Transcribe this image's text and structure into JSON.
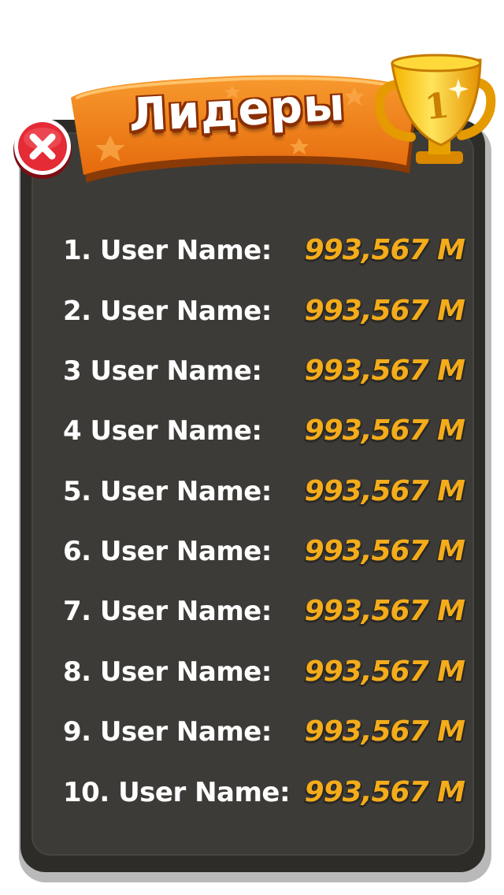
{
  "title": "Лидеры",
  "trophy_badge": "1",
  "colors": {
    "board": "#3d3b37",
    "banner": "#ef7b17",
    "score": "#f4ac1a",
    "close": "#e42b36"
  },
  "icons": {
    "close": "close-icon",
    "trophy": "trophy-icon"
  },
  "leaderboard": [
    {
      "name": "1. User Name:",
      "score": "993,567 M"
    },
    {
      "name": "2. User Name:",
      "score": "993,567 M"
    },
    {
      "name": "3 User Name:",
      "score": "993,567 M"
    },
    {
      "name": "4 User Name:",
      "score": "993,567 M"
    },
    {
      "name": "5. User Name:",
      "score": "993,567 M"
    },
    {
      "name": "6. User Name:",
      "score": "993,567 M"
    },
    {
      "name": "7. User Name:",
      "score": "993,567 M"
    },
    {
      "name": "8. User Name:",
      "score": "993,567 M"
    },
    {
      "name": "9. User Name:",
      "score": "993,567 M"
    },
    {
      "name": "10. User Name:",
      "score": "993,567 M"
    }
  ]
}
